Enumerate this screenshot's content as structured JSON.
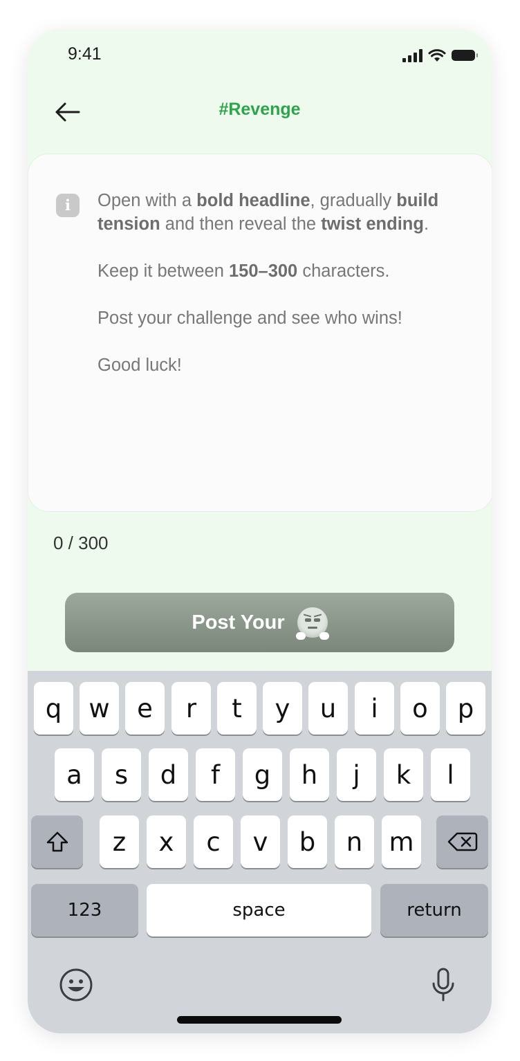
{
  "status_bar": {
    "time": "9:41"
  },
  "header": {
    "title": "#Revenge",
    "back_icon": "arrow-left-icon"
  },
  "hint": {
    "line1_a": "Open with a ",
    "line1_b": "bold headline",
    "line1_c": ", gradually ",
    "line1_d": "build tension",
    "line1_e": " and then reveal the ",
    "line1_f": "twist ending",
    "line1_g": ".",
    "line2_a": "Keep it between ",
    "line2_b": "150–300",
    "line2_c": " characters.",
    "line3": "Post your challenge and see who wins!",
    "line4": "Good luck!"
  },
  "counter": "0 / 300",
  "post_button": {
    "label": "Post Your"
  },
  "keyboard": {
    "row1": [
      "q",
      "w",
      "e",
      "r",
      "t",
      "y",
      "u",
      "i",
      "o",
      "p"
    ],
    "row2": [
      "a",
      "s",
      "d",
      "f",
      "g",
      "h",
      "j",
      "k",
      "l"
    ],
    "row3": [
      "z",
      "x",
      "c",
      "v",
      "b",
      "n",
      "m"
    ],
    "numbers": "123",
    "space": "space",
    "return": "return"
  },
  "colors": {
    "accent": "#2ea44a",
    "background": "#eefaee",
    "button": "#8a968a"
  }
}
